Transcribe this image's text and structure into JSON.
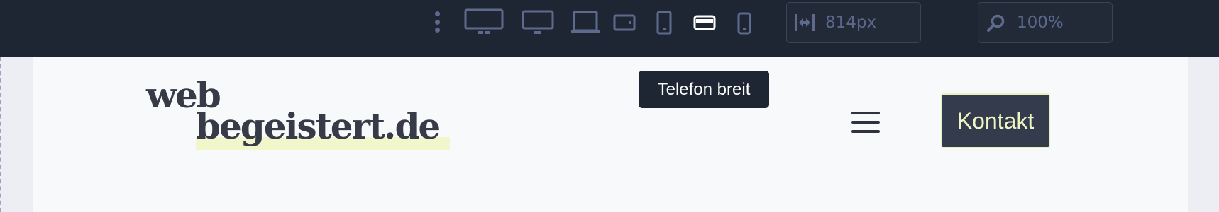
{
  "toolbar": {
    "devices": [
      {
        "name": "desktop-wide",
        "active": false
      },
      {
        "name": "desktop",
        "active": false
      },
      {
        "name": "laptop",
        "active": false
      },
      {
        "name": "tablet-landscape",
        "active": false
      },
      {
        "name": "tablet-portrait",
        "active": false
      },
      {
        "name": "phone-landscape",
        "active": true
      },
      {
        "name": "phone-portrait",
        "active": false
      }
    ],
    "width_value": "814px",
    "zoom_value": "100%",
    "tooltip": "Telefon breit"
  },
  "site": {
    "logo_line1": "web",
    "logo_line2": "begeistert.de",
    "contact_button": "Kontakt"
  },
  "colors": {
    "toolbar_bg": "#1f2633",
    "icon_muted": "#5d6a8c",
    "icon_active": "#ffffff",
    "page_bg": "#f8f9fb",
    "logo_text": "#373b47",
    "logo_highlight": "#f1f7cb",
    "button_bg": "#343b4d",
    "button_text": "#eef5c4"
  }
}
